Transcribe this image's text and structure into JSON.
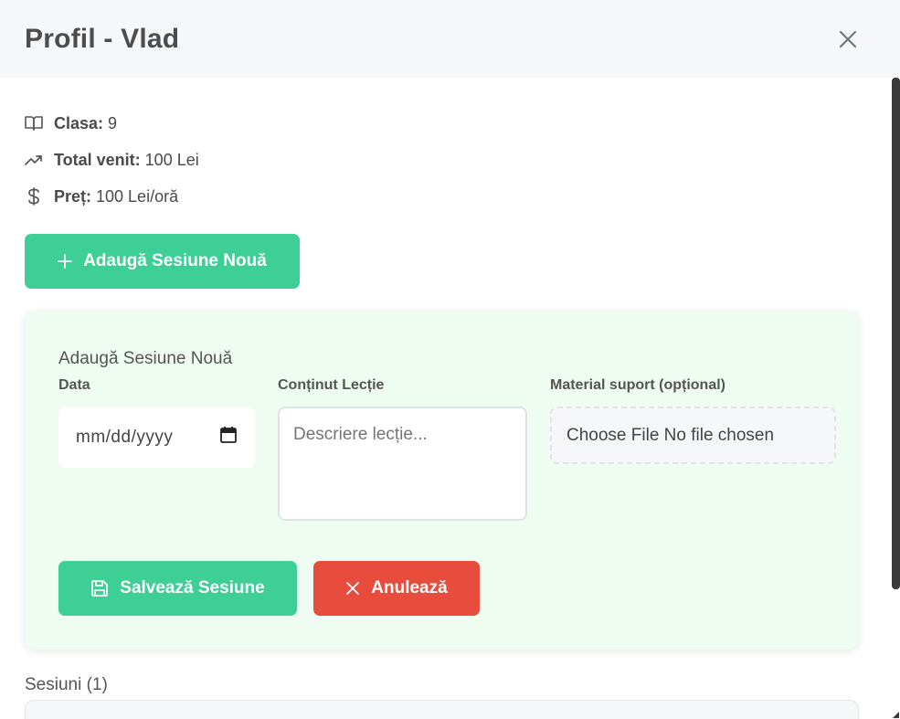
{
  "header": {
    "title": "Profil - Vlad"
  },
  "info": {
    "class_label": "Clasa:",
    "class_value": "9",
    "income_label": "Total venit:",
    "income_value": "100 Lei",
    "price_label": "Preț:",
    "price_value": "100 Lei/oră"
  },
  "actions": {
    "add_session_label": "Adaugă Sesiune Nouă"
  },
  "form": {
    "title": "Adaugă Sesiune Nouă",
    "date_label": "Data",
    "date_placeholder": "mm/dd/yyyy",
    "content_label": "Conținut Lecție",
    "content_placeholder": "Descriere lecție...",
    "material_label": "Material suport (opțional)",
    "file_text": "Choose File No file chosen",
    "save_label": "Salvează Sesiune",
    "cancel_label": "Anulează"
  },
  "sessions": {
    "title": "Sesiuni (1)"
  },
  "colors": {
    "primary": "#3dcf95",
    "danger": "#e84c3d",
    "panel_bg": "#eefcf2"
  },
  "icons": {
    "close": "close-icon",
    "class": "book-icon",
    "income": "trending-up-icon",
    "price": "dollar-icon",
    "add": "plus-icon",
    "calendar": "calendar-icon",
    "save": "save-icon",
    "cancel": "x-icon"
  }
}
